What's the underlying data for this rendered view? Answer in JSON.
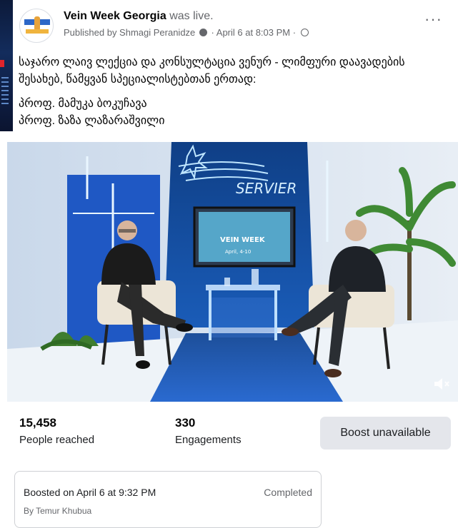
{
  "post": {
    "page_name": "Vein Week Georgia",
    "live_suffix": "was live.",
    "published_by": "Published by Shmagi Peranidze",
    "date_time": "April 6 at 8:03 PM",
    "separator": "·",
    "text_line1": "საჯარო ლაივ ლექცია და კონსულტაცია ვენურ - ლიმფური დაავადების შესახებ, წამყვან სპეციალისტებთან ერთად:",
    "text_line2": "პროფ. მამუკა ბოკუჩავა",
    "text_line3": "პროფ. ზაზა ლაზარაშვილი",
    "more_label": "···"
  },
  "video": {
    "sign_text": "SERVIER",
    "screen_title": "VEIN WEEK",
    "screen_subtitle": "April, 4-10"
  },
  "stats": {
    "reached_value": "15,458",
    "reached_label": "People reached",
    "engagements_value": "330",
    "engagements_label": "Engagements",
    "boost_button": "Boost unavailable"
  },
  "boost": {
    "boosted_on": "Boosted on April 6 at 9:32 PM",
    "status": "Completed",
    "by": "By Temur Khubua"
  },
  "colors": {
    "text_primary": "#050505",
    "text_secondary": "#65676b",
    "button_bg": "#e4e6eb",
    "studio_blue": "#1e5fc9",
    "neon": "#bfe6ff"
  },
  "icons": [
    "admin-badge-icon",
    "globe-icon",
    "more-options-icon",
    "mute-icon"
  ]
}
